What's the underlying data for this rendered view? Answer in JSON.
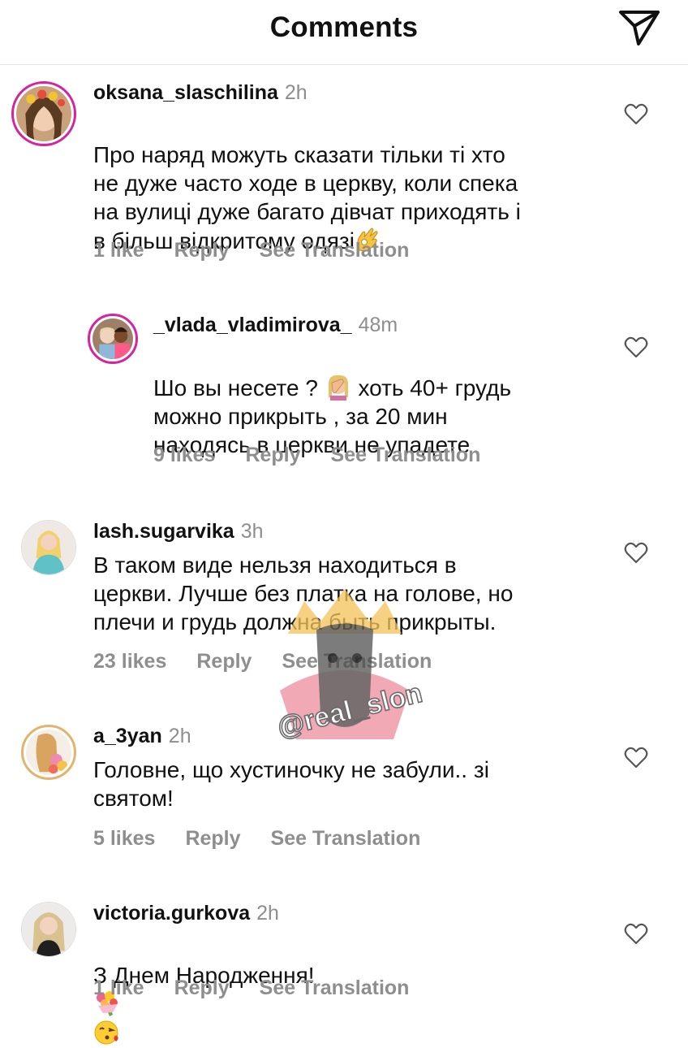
{
  "header": {
    "title": "Comments"
  },
  "comments": [
    {
      "username": "oksana_slaschilina",
      "time": "2h",
      "text": "Про наряд можуть сказати тільки ті хто\nне дуже часто ходе в церкву, коли спека\nна вулиці дуже багато дівчат приходять і\nв більш відкритому одязі",
      "emoji": "ok-hand",
      "likes": "1 like",
      "reply": "Reply",
      "translate": "See Translation"
    },
    {
      "username": "_vlada_vladimirova_",
      "time": "48m",
      "text_a": "Шо вы несете ?",
      "emoji": "facepalm",
      "text_b": "хоть 40+ грудь\nможно прикрыть , за 20 мин\nнаходясь в церкви не упадете",
      "likes": "9 likes",
      "reply": "Reply",
      "translate": "See Translation"
    },
    {
      "username": "lash.sugarvika",
      "time": "3h",
      "text": "В таком виде нельзя находиться в\nцеркви. Лучше без платка на голове, но\nплечи и грудь должна быть прикрыты.",
      "likes": "23 likes",
      "reply": "Reply",
      "translate": "See Translation"
    },
    {
      "username": "a_3yan",
      "time": "2h",
      "text": "Головне, що хустиночку не забули.. зі\nсвятом!",
      "likes": "5 likes",
      "reply": "Reply",
      "translate": "See Translation"
    },
    {
      "username": "victoria.gurkova",
      "time": "2h",
      "text": "З Днем Народження!",
      "emoji": [
        "bouquet",
        "face-blowing-kiss"
      ],
      "likes": "1 like",
      "reply": "Reply",
      "translate": "See Translation"
    }
  ],
  "watermark": {
    "text": "@real_slon"
  },
  "colors": {
    "text": "#111111",
    "muted": "#8e8e8e",
    "story_ring": "#d6249f",
    "divider": "#e4e4e4"
  },
  "icons": [
    "paper-plane-icon",
    "heart-outline-icon",
    "avatar-photo"
  ]
}
